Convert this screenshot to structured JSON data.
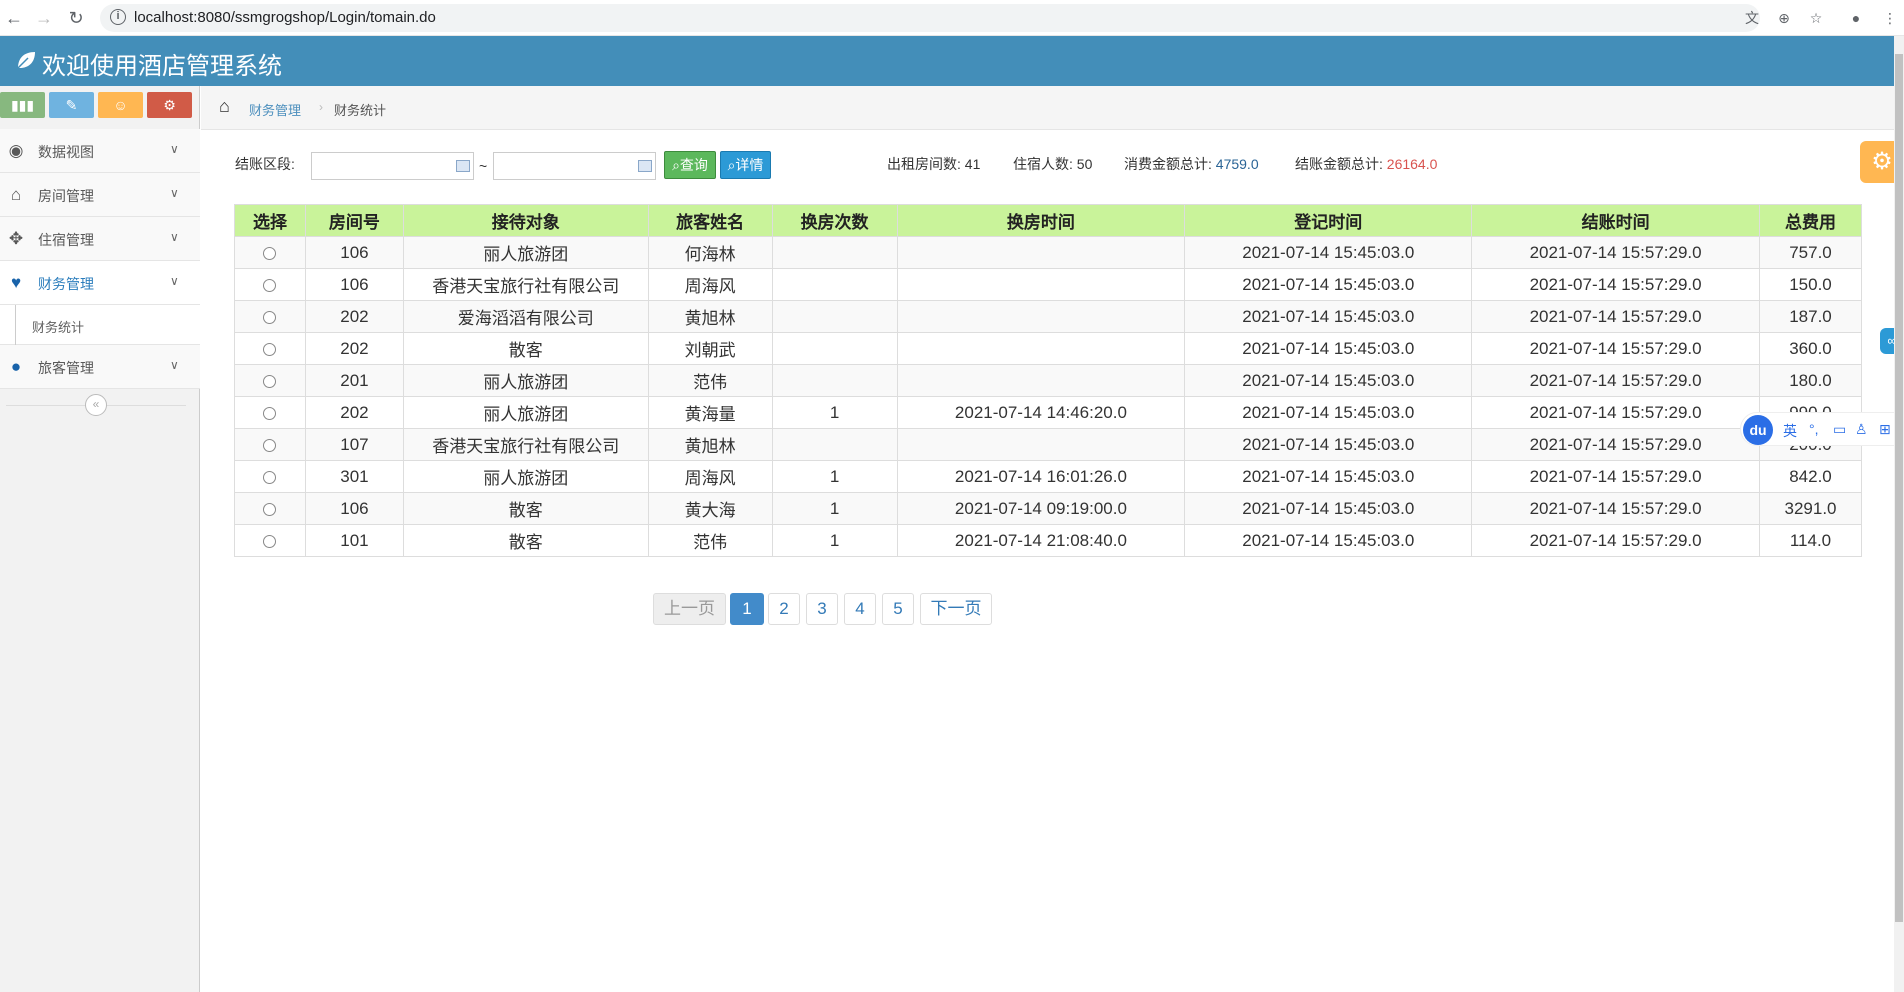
{
  "browser": {
    "url": "localhost:8080/ssmgrogshop/Login/tomain.do"
  },
  "app": {
    "title": "欢迎使用酒店管理系统"
  },
  "sidebar": {
    "items": [
      {
        "label": "数据视图",
        "icon": "dashboard-icon"
      },
      {
        "label": "房间管理",
        "icon": "home-icon"
      },
      {
        "label": "住宿管理",
        "icon": "move-icon"
      },
      {
        "label": "财务管理",
        "icon": "heart-icon"
      },
      {
        "label": "旅客管理",
        "icon": "user-icon"
      }
    ],
    "submenu": {
      "label": "财务统计"
    }
  },
  "breadcrumb": {
    "parent": "财务管理",
    "current": "财务统计"
  },
  "filter": {
    "label": "结账区段:",
    "tilde": "~",
    "query_button": "查询",
    "detail_button": "详情"
  },
  "stats": {
    "rooms_label": "出租房间数:",
    "rooms_value": "41",
    "guests_label": "住宿人数:",
    "guests_value": "50",
    "consume_label": "消费金额总计:",
    "consume_value": "4759.0",
    "checkout_label": "结账金额总计:",
    "checkout_value": "26164.0"
  },
  "table": {
    "headers": [
      "选择",
      "房间号",
      "接待对象",
      "旅客姓名",
      "换房次数",
      "换房时间",
      "登记时间",
      "结账时间",
      "总费用"
    ],
    "rows": [
      [
        "106",
        "丽人旅游团",
        "何海林",
        "",
        "",
        "2021-07-14 15:45:03.0",
        "2021-07-14 15:57:29.0",
        "757.0"
      ],
      [
        "106",
        "香港天宝旅行社有限公司",
        "周海风",
        "",
        "",
        "2021-07-14 15:45:03.0",
        "2021-07-14 15:57:29.0",
        "150.0"
      ],
      [
        "202",
        "爱海滔滔有限公司",
        "黄旭林",
        "",
        "",
        "2021-07-14 15:45:03.0",
        "2021-07-14 15:57:29.0",
        "187.0"
      ],
      [
        "202",
        "散客",
        "刘朝武",
        "",
        "",
        "2021-07-14 15:45:03.0",
        "2021-07-14 15:57:29.0",
        "360.0"
      ],
      [
        "201",
        "丽人旅游团",
        "范伟",
        "",
        "",
        "2021-07-14 15:45:03.0",
        "2021-07-14 15:57:29.0",
        "180.0"
      ],
      [
        "202",
        "丽人旅游团",
        "黄海量",
        "1",
        "2021-07-14 14:46:20.0",
        "2021-07-14 15:45:03.0",
        "2021-07-14 15:57:29.0",
        "990.0"
      ],
      [
        "107",
        "香港天宝旅行社有限公司",
        "黄旭林",
        "",
        "",
        "2021-07-14 15:45:03.0",
        "2021-07-14 15:57:29.0",
        "200.0"
      ],
      [
        "301",
        "丽人旅游团",
        "周海风",
        "1",
        "2021-07-14 16:01:26.0",
        "2021-07-14 15:45:03.0",
        "2021-07-14 15:57:29.0",
        "842.0"
      ],
      [
        "106",
        "散客",
        "黄大海",
        "1",
        "2021-07-14 09:19:00.0",
        "2021-07-14 15:45:03.0",
        "2021-07-14 15:57:29.0",
        "3291.0"
      ],
      [
        "101",
        "散客",
        "范伟",
        "1",
        "2021-07-14 21:08:40.0",
        "2021-07-14 15:45:03.0",
        "2021-07-14 15:57:29.0",
        "114.0"
      ]
    ]
  },
  "pagination": {
    "prev": "上一页",
    "pages": [
      "1",
      "2",
      "3",
      "4",
      "5"
    ],
    "next": "下一页",
    "active": "1"
  },
  "ime": {
    "logo": "du",
    "lang": "英"
  },
  "colors": {
    "header": "#438eb9",
    "table_header": "#c9f39a",
    "query_button": "#5cb85c",
    "detail_button": "#2c9ad6",
    "consume_value": "#2a6496",
    "checkout_value": "#d9534f"
  }
}
